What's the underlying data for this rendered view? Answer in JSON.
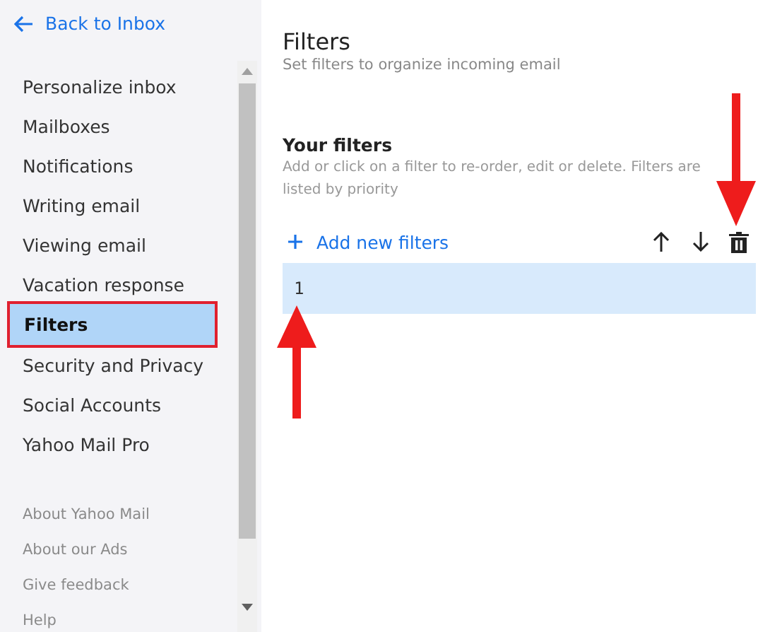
{
  "back_link": {
    "label": "Back to Inbox"
  },
  "sidebar": {
    "items": [
      {
        "label": "Personalize inbox",
        "selected": false
      },
      {
        "label": "Mailboxes",
        "selected": false
      },
      {
        "label": "Notifications",
        "selected": false
      },
      {
        "label": "Writing email",
        "selected": false
      },
      {
        "label": "Viewing email",
        "selected": false
      },
      {
        "label": "Vacation response",
        "selected": false
      },
      {
        "label": "Filters",
        "selected": true
      },
      {
        "label": "Security and Privacy",
        "selected": false
      },
      {
        "label": "Social Accounts",
        "selected": false
      },
      {
        "label": "Yahoo Mail Pro",
        "selected": false
      }
    ],
    "footer_links": [
      "About Yahoo Mail",
      "About our Ads",
      "Give feedback",
      "Help"
    ]
  },
  "page": {
    "title": "Filters",
    "subtitle": "Set filters to organize incoming email",
    "section_title": "Your filters",
    "description": "Add or click on a filter to re-order, edit or delete. Filters are listed by priority",
    "add_button": "Add new filters",
    "filters": [
      {
        "name": "1",
        "selected": true
      }
    ]
  }
}
